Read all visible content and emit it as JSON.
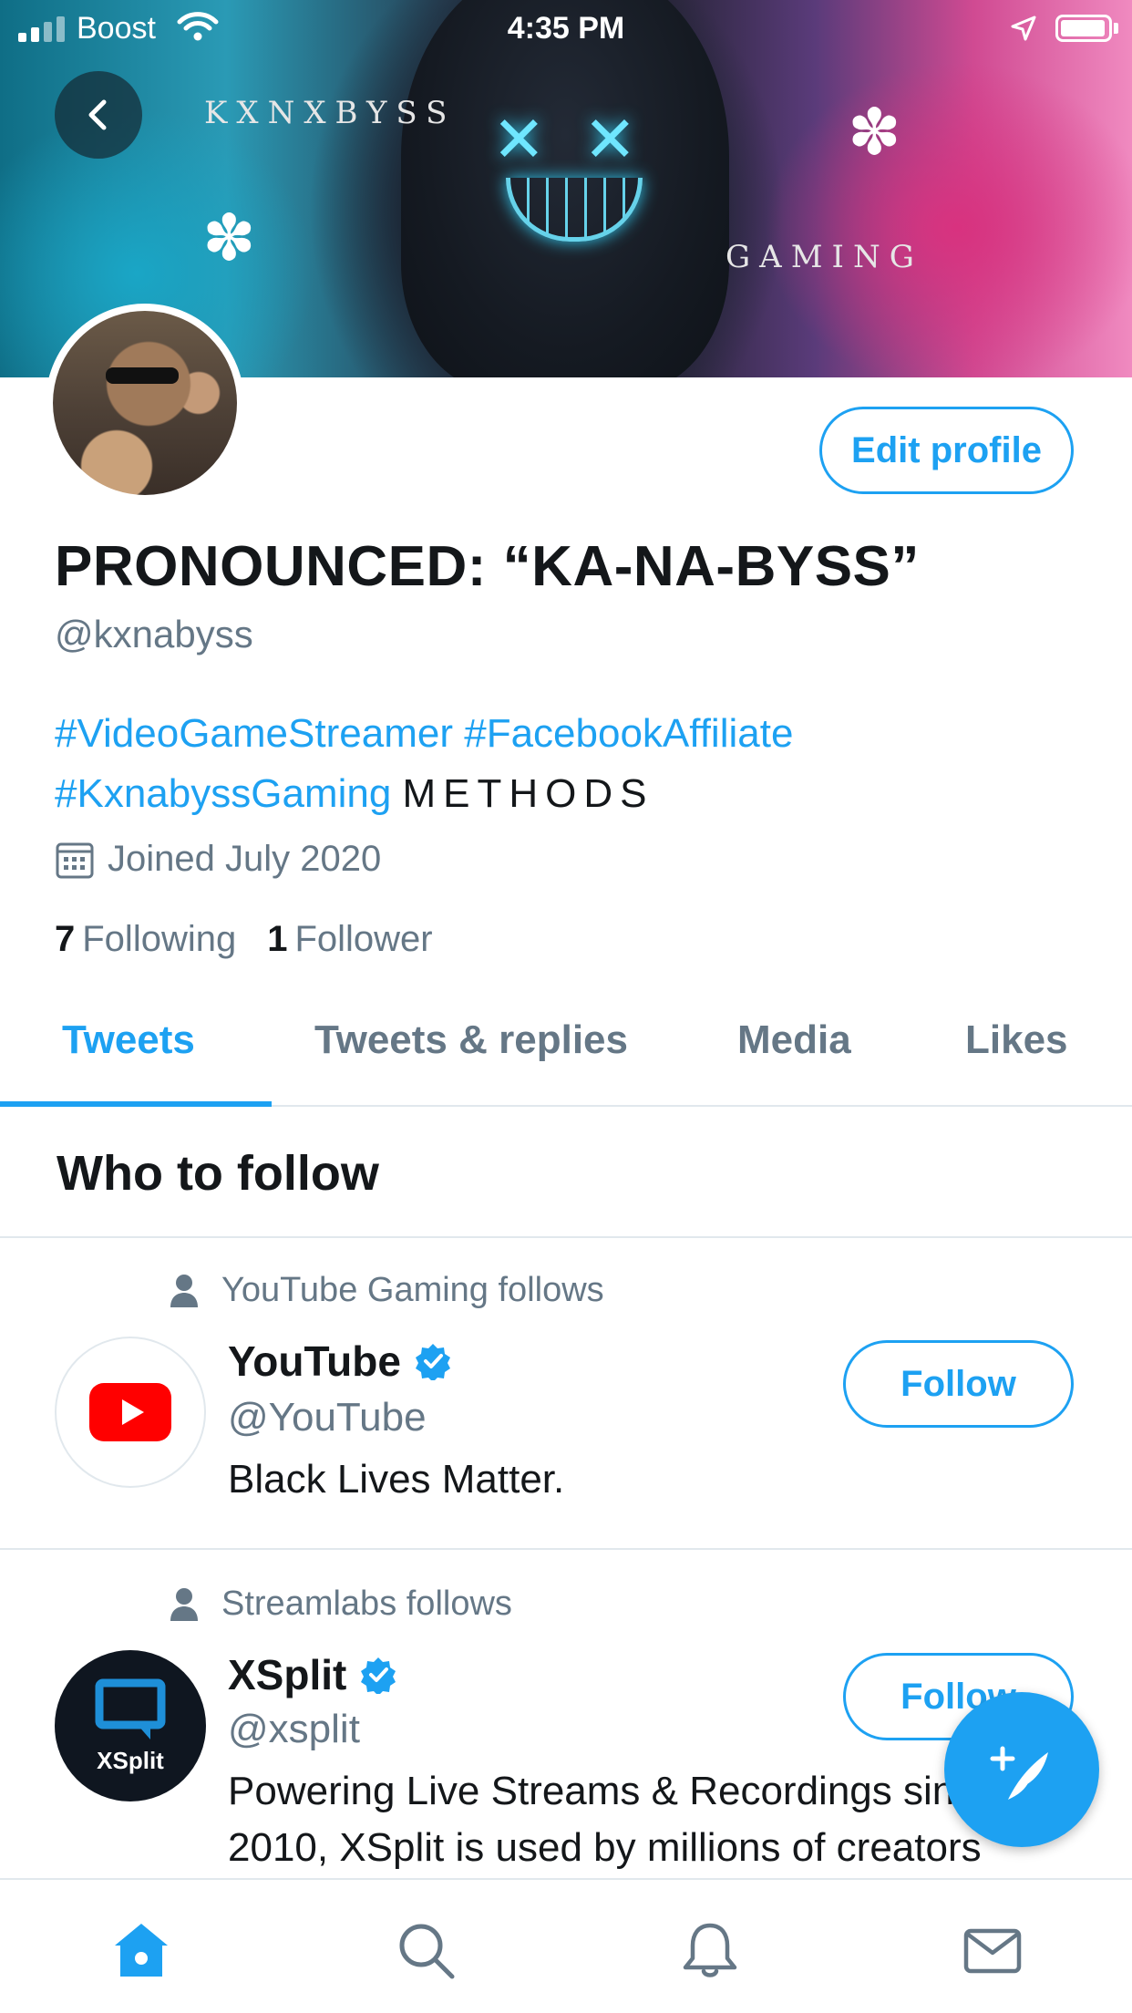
{
  "status_bar": {
    "carrier": "Boost",
    "time": "4:35 PM"
  },
  "banner": {
    "text_top": "KXNXBYSS",
    "text_bottom": "GAMING"
  },
  "profile": {
    "edit_button": "Edit profile",
    "name": "PRONOUNCED: “KA-NA-BYSS”",
    "handle": "@kxnabyss",
    "bio": {
      "tag1": "#VideoGameStreamer",
      "tag2": "#FacebookAffiliate",
      "tag3": "#KxnabyssGaming",
      "text": "METHODS"
    },
    "joined": "Joined July 2020",
    "following_count": "7",
    "following_label": "Following",
    "followers_count": "1",
    "followers_label": "Follower"
  },
  "tabs": [
    {
      "label": "Tweets",
      "active": true
    },
    {
      "label": "Tweets & replies",
      "active": false
    },
    {
      "label": "Media",
      "active": false
    },
    {
      "label": "Likes",
      "active": false
    }
  ],
  "who_to_follow": {
    "title": "Who to follow",
    "items": [
      {
        "context": "YouTube Gaming follows",
        "name": "YouTube",
        "handle": "@YouTube",
        "bio": "Black Lives Matter.",
        "button": "Follow"
      },
      {
        "context": "Streamlabs follows",
        "name": "XSplit",
        "handle": "@xsplit",
        "bio_line1": "Powering Live Streams & Recordings since",
        "bio_line2": "2010, XSplit is used by millions of creators",
        "button": "Follow",
        "avatar_text": "XSplit"
      }
    ]
  },
  "colors": {
    "accent": "#1da1f2",
    "secondary_text": "#657786",
    "youtube_red": "#ff0000"
  }
}
